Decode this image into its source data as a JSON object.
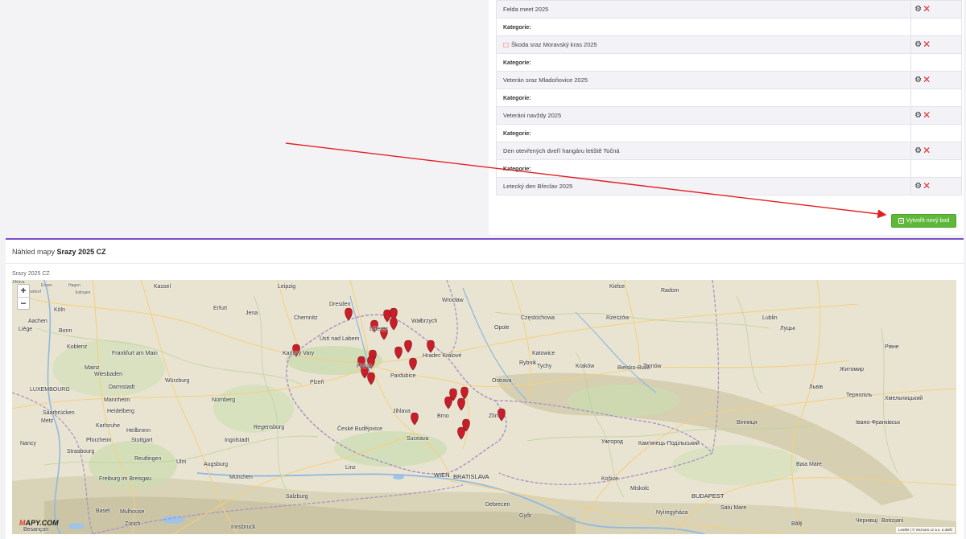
{
  "events": {
    "category_label": "Kategorie:",
    "items": [
      {
        "name": "Felda meet 2025",
        "has_image": false
      },
      {
        "name": "Škoda sraz Moravský kras 2025",
        "has_image": true
      },
      {
        "name": "Veterán sraz Mladoňovice 2025",
        "has_image": false
      },
      {
        "name": "Veteráni navždy 2025",
        "has_image": false
      },
      {
        "name": "Den otevřených dveří hangáru letiště Točná",
        "has_image": false
      },
      {
        "name": "Letecký den Břeclav 2025",
        "has_image": false
      }
    ],
    "new_point_label": "Vytvořit nový bod"
  },
  "map": {
    "header_prefix": "Náhled mapy",
    "header_name": "Srazy 2025 CZ",
    "sublabel": "Srazy 2025 CZ",
    "zoom_in": "+",
    "zoom_out": "−",
    "logo_first": "M",
    "logo_rest": "APY.COM",
    "attribution": "Leaflet | © Seznam.cz a.s. a další",
    "colors": {
      "marker": "#c81e2a",
      "accent": "#7b4fc9",
      "button": "#5fb83a",
      "delete": "#e0302c"
    },
    "cities": [
      {
        "name": "Essen",
        "c": "small"
      },
      {
        "name": "Hagen",
        "c": "small"
      },
      {
        "name": "Düsseldorf",
        "c": "small"
      },
      {
        "name": "Solingen",
        "c": "small"
      },
      {
        "name": "Köln",
        "c": ""
      },
      {
        "name": "Aachen",
        "c": ""
      },
      {
        "name": "Liège",
        "c": ""
      },
      {
        "name": "Bonn",
        "c": ""
      },
      {
        "name": "Koblenz",
        "c": ""
      },
      {
        "name": "Frankfurt am Main",
        "c": ""
      },
      {
        "name": "Wiesbaden",
        "c": ""
      },
      {
        "name": "Mainz",
        "c": ""
      },
      {
        "name": "LUXEMBOURG",
        "c": ""
      },
      {
        "name": "Darmstadt",
        "c": ""
      },
      {
        "name": "Mannheim",
        "c": ""
      },
      {
        "name": "Saarbrücken",
        "c": ""
      },
      {
        "name": "Heidelberg",
        "c": ""
      },
      {
        "name": "Metz",
        "c": ""
      },
      {
        "name": "Karlsruhe",
        "c": ""
      },
      {
        "name": "Heilbronn",
        "c": ""
      },
      {
        "name": "Pforzheim",
        "c": ""
      },
      {
        "name": "Stuttgart",
        "c": ""
      },
      {
        "name": "Nancy",
        "c": ""
      },
      {
        "name": "Strasbourg",
        "c": ""
      },
      {
        "name": "Reutlingen",
        "c": ""
      },
      {
        "name": "Ulm",
        "c": ""
      },
      {
        "name": "Augsburg",
        "c": ""
      },
      {
        "name": "Freiburg im Breisgau",
        "c": ""
      },
      {
        "name": "Basel",
        "c": ""
      },
      {
        "name": "Zürich",
        "c": ""
      },
      {
        "name": "Mulhouse",
        "c": ""
      },
      {
        "name": "Besançon",
        "c": ""
      },
      {
        "name": "Kassel",
        "c": ""
      },
      {
        "name": "Erfurt",
        "c": ""
      },
      {
        "name": "Jena",
        "c": ""
      },
      {
        "name": "Leipzig",
        "c": ""
      },
      {
        "name": "Chemnitz",
        "c": ""
      },
      {
        "name": "Dresden",
        "c": ""
      },
      {
        "name": "Würzburg",
        "c": ""
      },
      {
        "name": "Nürnberg",
        "c": ""
      },
      {
        "name": "Regensburg",
        "c": ""
      },
      {
        "name": "Ingolstadt",
        "c": ""
      },
      {
        "name": "München",
        "c": ""
      },
      {
        "name": "Salzburg",
        "c": ""
      },
      {
        "name": "Innsbruck",
        "c": ""
      },
      {
        "name": "Linz",
        "c": ""
      },
      {
        "name": "Karlovy Vary",
        "c": ""
      },
      {
        "name": "Ústí nad Labem",
        "c": ""
      },
      {
        "name": "Liberec",
        "c": ""
      },
      {
        "name": "Plzeň",
        "c": ""
      },
      {
        "name": "Praha",
        "c": ""
      },
      {
        "name": "České Budějovice",
        "c": ""
      },
      {
        "name": "Jihlava",
        "c": ""
      },
      {
        "name": "Pardubice",
        "c": ""
      },
      {
        "name": "Hradec Králové",
        "c": ""
      },
      {
        "name": "Brno",
        "c": ""
      },
      {
        "name": "Ostrava",
        "c": ""
      },
      {
        "name": "Zlín",
        "c": ""
      },
      {
        "name": "WIEN",
        "c": "big"
      },
      {
        "name": "BRATISLAVA",
        "c": "big"
      },
      {
        "name": "Wrocław",
        "c": ""
      },
      {
        "name": "Wałbrzych",
        "c": ""
      },
      {
        "name": "Opole",
        "c": ""
      },
      {
        "name": "Częstochowa",
        "c": ""
      },
      {
        "name": "Katowice",
        "c": ""
      },
      {
        "name": "Rybnik",
        "c": ""
      },
      {
        "name": "Tychy",
        "c": ""
      },
      {
        "name": "Kraków",
        "c": ""
      },
      {
        "name": "Bielsko-Biała",
        "c": ""
      },
      {
        "name": "Tarnów",
        "c": ""
      },
      {
        "name": "Rzeszów",
        "c": ""
      },
      {
        "name": "Kielce",
        "c": ""
      },
      {
        "name": "Radom",
        "c": ""
      },
      {
        "name": "Lublin",
        "c": ""
      },
      {
        "name": "Луцьк",
        "c": ""
      },
      {
        "name": "Рівне",
        "c": ""
      },
      {
        "name": "Житомир",
        "c": ""
      },
      {
        "name": "Львів",
        "c": ""
      },
      {
        "name": "Тернопіль",
        "c": ""
      },
      {
        "name": "Хмельницький",
        "c": ""
      },
      {
        "name": "Вінниця",
        "c": ""
      },
      {
        "name": "Івано-Франківськ",
        "c": ""
      },
      {
        "name": "Кам'янець-Подільський",
        "c": ""
      },
      {
        "name": "Ужгород",
        "c": ""
      },
      {
        "name": "Košice",
        "c": ""
      },
      {
        "name": "Miskolc",
        "c": ""
      },
      {
        "name": "Nyíregyháza",
        "c": ""
      },
      {
        "name": "Debrecen",
        "c": ""
      },
      {
        "name": "Győr",
        "c": ""
      },
      {
        "name": "BUDAPEST",
        "c": "big"
      },
      {
        "name": "Satu Mare",
        "c": ""
      },
      {
        "name": "Baia Mare",
        "c": ""
      },
      {
        "name": "Чернівці",
        "c": ""
      },
      {
        "name": "Botoșani",
        "c": ""
      },
      {
        "name": "Bălți",
        "c": ""
      },
      {
        "name": "Suceava",
        "c": ""
      },
      {
        "name": "Jihlava",
        "c": "small"
      }
    ]
  }
}
